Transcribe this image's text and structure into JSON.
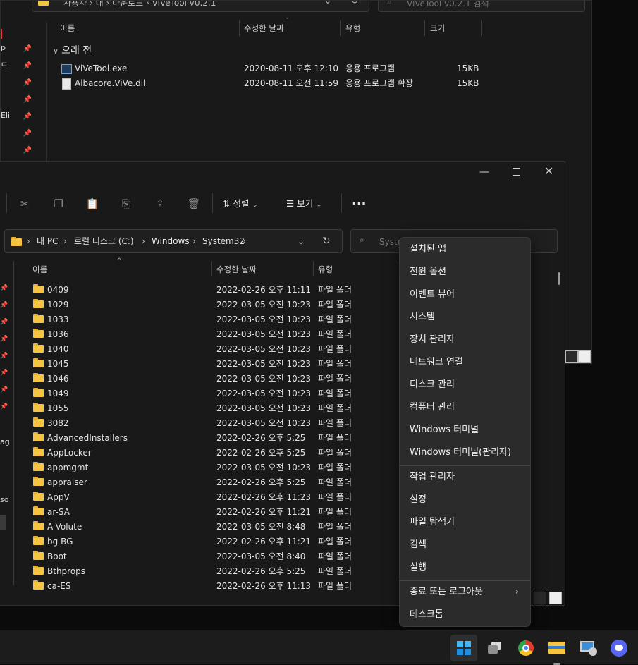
{
  "back_window": {
    "address_segments": [
      "사용자",
      "내",
      "다운로드",
      "ViVeTool v0.2.1"
    ],
    "search_placeholder": "ViVeTool v0.2.1 검색",
    "columns": [
      "이름",
      "수정한 날짜",
      "유형",
      "크기"
    ],
    "group_label": "오래 전",
    "files": [
      {
        "name": "ViVeTool.exe",
        "date": "2020-08-11 오후 12:10",
        "type": "응용 프로그램",
        "size": "15KB"
      },
      {
        "name": "Albacore.ViVe.dll",
        "date": "2020-08-11 오전 11:59",
        "type": "응용 프로그램 확장",
        "size": "15KB"
      }
    ],
    "left_labels": [
      "p",
      "드",
      "",
      "",
      "Eli",
      "",
      "",
      "",
      "",
      ""
    ]
  },
  "front_window": {
    "toolbar": {
      "sort_label": "정렬",
      "view_label": "보기",
      "more_label": "..."
    },
    "breadcrumb": [
      "내 PC",
      "로컬 디스크 (C:)",
      "Windows",
      "System32"
    ],
    "search_placeholder": "System32 검색",
    "columns": [
      "이름",
      "수정한 날짜",
      "유형"
    ],
    "left_labels": [
      "ag",
      "so"
    ],
    "rows": [
      {
        "name": "0409",
        "date": "2022-02-26 오후 11:11",
        "type": "파일 폴더"
      },
      {
        "name": "1029",
        "date": "2022-03-05 오전 10:23",
        "type": "파일 폴더"
      },
      {
        "name": "1033",
        "date": "2022-03-05 오전 10:23",
        "type": "파일 폴더"
      },
      {
        "name": "1036",
        "date": "2022-03-05 오전 10:23",
        "type": "파일 폴더"
      },
      {
        "name": "1040",
        "date": "2022-03-05 오전 10:23",
        "type": "파일 폴더"
      },
      {
        "name": "1045",
        "date": "2022-03-05 오전 10:23",
        "type": "파일 폴더"
      },
      {
        "name": "1046",
        "date": "2022-03-05 오전 10:23",
        "type": "파일 폴더"
      },
      {
        "name": "1049",
        "date": "2022-03-05 오전 10:23",
        "type": "파일 폴더"
      },
      {
        "name": "1055",
        "date": "2022-03-05 오전 10:23",
        "type": "파일 폴더"
      },
      {
        "name": "3082",
        "date": "2022-03-05 오전 10:23",
        "type": "파일 폴더"
      },
      {
        "name": "AdvancedInstallers",
        "date": "2022-02-26 오후 5:25",
        "type": "파일 폴더"
      },
      {
        "name": "AppLocker",
        "date": "2022-02-26 오후 5:25",
        "type": "파일 폴더"
      },
      {
        "name": "appmgmt",
        "date": "2022-03-05 오전 10:23",
        "type": "파일 폴더"
      },
      {
        "name": "appraiser",
        "date": "2022-02-26 오후 5:25",
        "type": "파일 폴더"
      },
      {
        "name": "AppV",
        "date": "2022-02-26 오후 11:23",
        "type": "파일 폴더"
      },
      {
        "name": "ar-SA",
        "date": "2022-02-26 오후 11:21",
        "type": "파일 폴더"
      },
      {
        "name": "A-Volute",
        "date": "2022-03-05 오전 8:48",
        "type": "파일 폴더"
      },
      {
        "name": "bg-BG",
        "date": "2022-02-26 오후 11:21",
        "type": "파일 폴더"
      },
      {
        "name": "Boot",
        "date": "2022-03-05 오전 8:40",
        "type": "파일 폴더"
      },
      {
        "name": "Bthprops",
        "date": "2022-02-26 오후 5:25",
        "type": "파일 폴더"
      },
      {
        "name": "ca-ES",
        "date": "2022-02-26 오후 11:13",
        "type": "파일 폴더"
      }
    ]
  },
  "context_menu": {
    "groups": [
      [
        "설치된 앱",
        "전원 옵션",
        "이벤트 뷰어",
        "시스템",
        "장치 관리자",
        "네트워크 연결",
        "디스크 관리",
        "컴퓨터 관리",
        "Windows 터미널",
        "Windows 터미널(관리자)"
      ],
      [
        "작업 관리자",
        "설정",
        "파일 탐색기",
        "검색",
        "실행"
      ],
      [
        "종료 또는 로그아웃",
        "데스크톱"
      ]
    ],
    "submenu_arrow": "›"
  },
  "taskbar": {
    "icons": [
      "start-icon",
      "task-view-icon",
      "chrome-icon",
      "file-explorer-icon",
      "remote-desktop-icon",
      "discord-icon"
    ]
  },
  "colors": {
    "accent": "#0078d4",
    "folder": "#f5c542",
    "menu_bg": "#2b2b2b",
    "window_bg": "#191919"
  }
}
